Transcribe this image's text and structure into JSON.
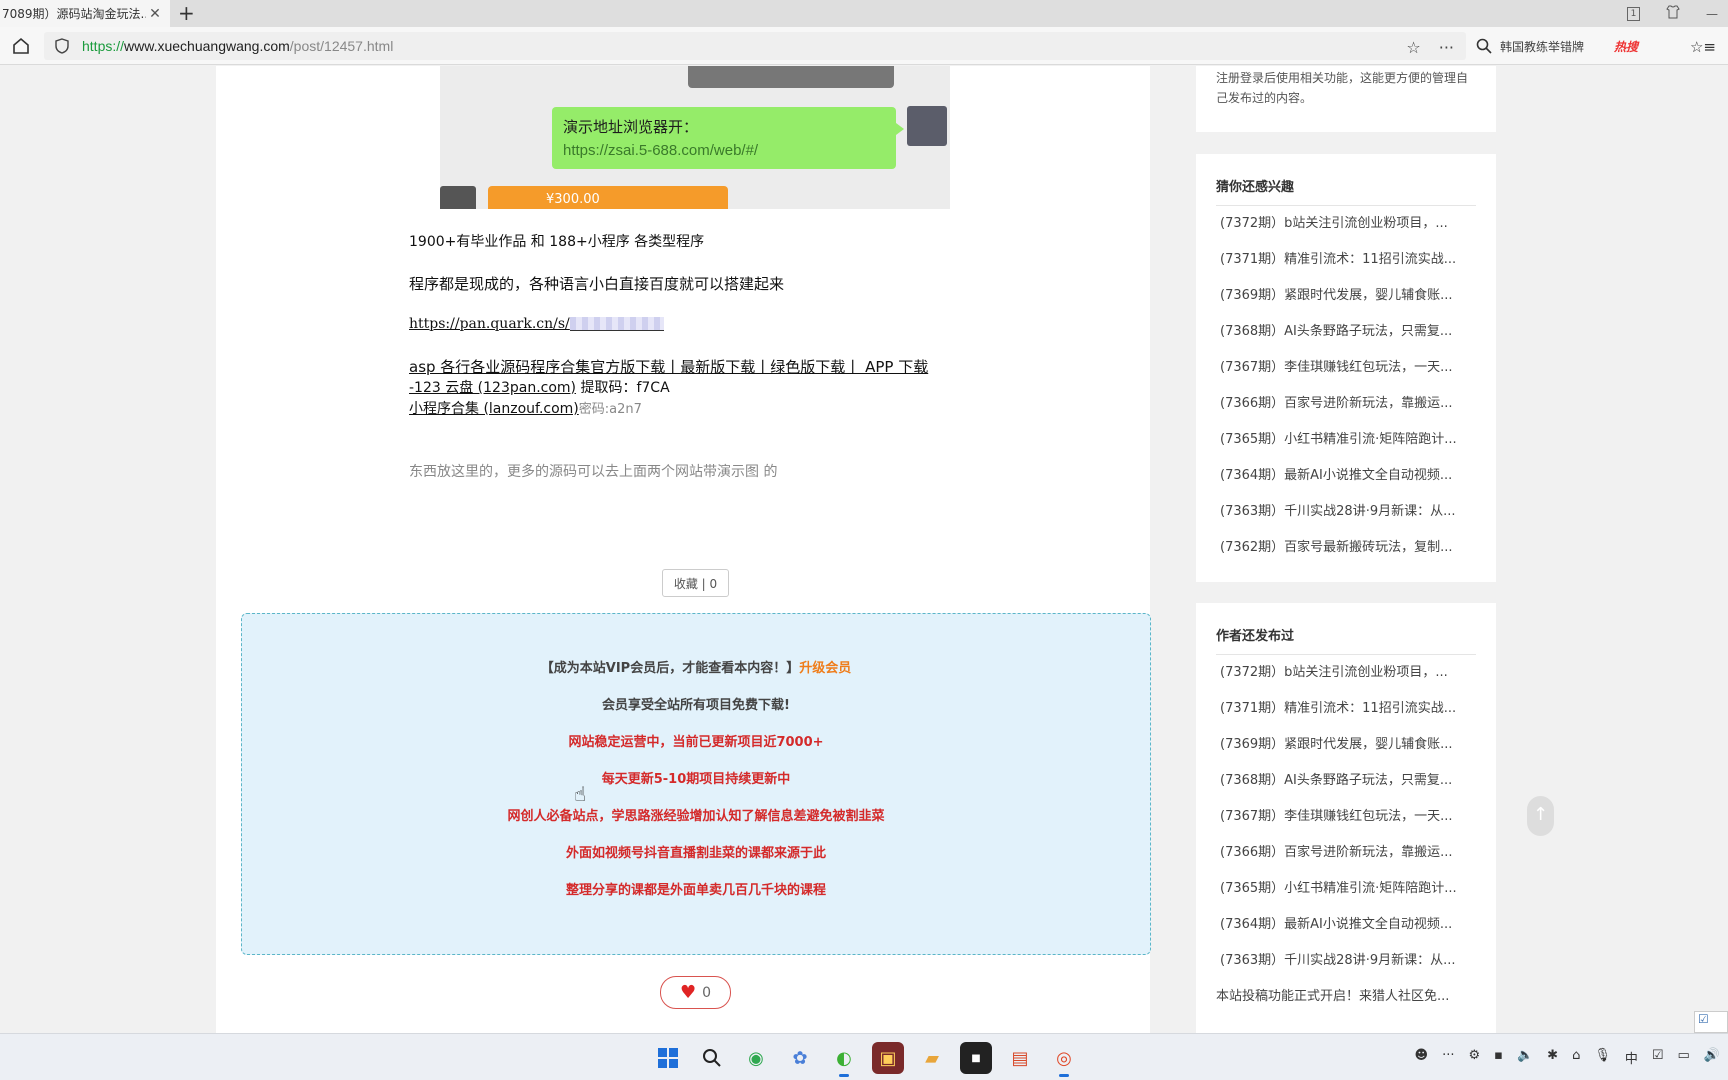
{
  "browser": {
    "tab_title": "7089期）源码站淘金玩法...",
    "tab_close": "✕",
    "new_tab": "+",
    "url_proto": "https://",
    "url_domain": "www.xuechuangwang.com",
    "url_path": "/post/12457.html",
    "search_text": "韩国教练举错牌",
    "search_hot": "热搜",
    "window_badge": "1"
  },
  "sidebar_intro": [
    "注册登录后使用相关功能，这能更方便的管理自",
    "己发布过的内容。"
  ],
  "screenshot": {
    "bubble_line1": "演示地址浏览器开：",
    "bubble_line2": "https://zsai.5-688.com/web/#/",
    "orange_price": "¥300.00"
  },
  "article": {
    "p1": "1900+有毕业作品 和 188+小程序 各类型程序",
    "p2": "程序都是现成的，各种语言小白直接百度就可以搭建起来",
    "quark_link": "https://pan.quark.cn/s/",
    "asp_link_line1": "asp 各行各业源码程序合集官方版下载丨最新版下载丨绿色版下载丨 APP 下载",
    "asp_link_line2": "-123 云盘 (123pan.com)",
    "asp_code": " 提取码：f7CA",
    "mini_link": "小程序合集 (lanzouf.com)",
    "mini_code": "密码:a2n7",
    "note": "东西放这里的，更多的源码可以去上面两个网站带演示图 的",
    "favorite_btn": "收藏 | 0",
    "like_count": "0"
  },
  "vip": {
    "line1_prefix": "【成为本站VIP会员后，才能查看本内容！】",
    "line1_link": "升级会员",
    "line2": "会员享受全站所有项目免费下载!",
    "line3": "网站稳定运营中，当前已更新项目近7000+",
    "line4": "每天更新5-10期项目持续更新中",
    "line5": "网创人必备站点，学思路涨经验增加认知了解信息差避免被割韭菜",
    "line6": "外面如视频号抖音直播割韭菜的课都来源于此",
    "line7": "整理分享的课都是外面单卖几百几千块的课程"
  },
  "sidebar_interest": {
    "title": "猜你还感兴趣",
    "items": [
      "(7372期）b站关注引流创业粉项目，...",
      "(7371期）精准引流术：11招引流实战...",
      "(7369期）紧跟时代发展，婴儿辅食账...",
      "(7368期）AI头条野路子玩法，只需复...",
      "(7367期）李佳琪赚钱红包玩法，一天...",
      "(7366期）百家号进阶新玩法，靠搬运...",
      "(7365期）小红书精准引流·矩阵陪跑计...",
      "(7364期）最新AI小说推文全自动视频...",
      "(7363期）千川实战28讲·9月新课：从...",
      "(7362期）百家号最新搬砖玩法，复制..."
    ]
  },
  "sidebar_author": {
    "title": "作者还发布过",
    "items": [
      "(7372期）b站关注引流创业粉项目，...",
      "(7371期）精准引流术：11招引流实战...",
      "(7369期）紧跟时代发展，婴儿辅食账...",
      "(7368期）AI头条野路子玩法，只需复...",
      "(7367期）李佳琪赚钱红包玩法，一天...",
      "(7366期）百家号进阶新玩法，靠搬运...",
      "(7365期）小红书精准引流·矩阵陪跑计...",
      "(7364期）最新AI小说推文全自动视频...",
      "(7363期）千川实战28讲·9月新课：从..."
    ],
    "footer": "本站投稿功能正式开启！来猎人社区免..."
  }
}
